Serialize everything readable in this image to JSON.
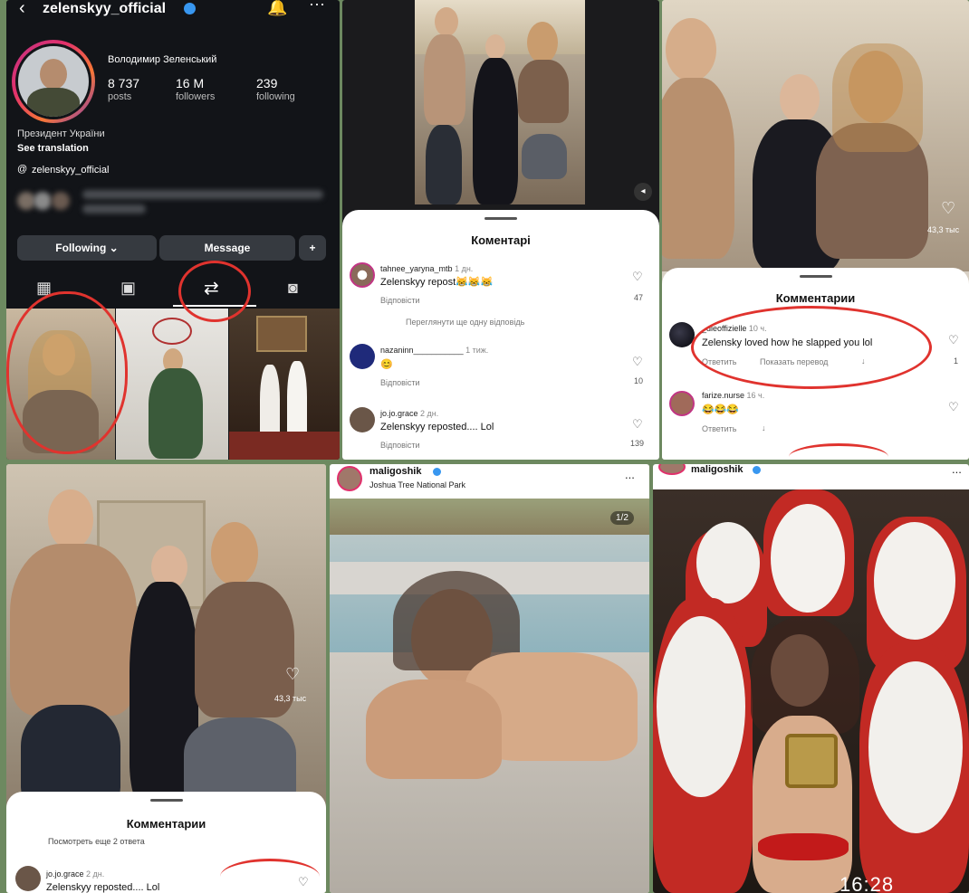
{
  "profile": {
    "username": "zelenskyy_official",
    "display_name": "Володимир Зеленський",
    "posts_count": "8 737",
    "posts_label": "posts",
    "followers_count": "16 M",
    "followers_label": "followers",
    "following_count": "239",
    "following_label": "following",
    "bio": "Президент України",
    "see_translation": "See translation",
    "threads_handle": "zelenskyy_official",
    "following_button": "Following",
    "message_button": "Message",
    "icons": {
      "back": "chevron-left-icon",
      "verified": "verified-badge-icon",
      "bell": "bell-icon",
      "more": "more-icon",
      "grid": "grid-icon",
      "reels": "reels-icon",
      "reposts": "repost-icon",
      "tagged": "tagged-icon",
      "add_user": "add-user-icon"
    }
  },
  "ukrainian_comments": {
    "title": "Коментарі",
    "comments": [
      {
        "user": "tahnee_yaryna_mtb",
        "time": "1 дн.",
        "text": "Zelenskyy repost😹😹😹",
        "reply": "Відповісти",
        "likes": "47"
      },
      {
        "more_replies": "Переглянути ще одну відповідь"
      },
      {
        "user": "nazaninn___________",
        "time": "1 тиж.",
        "text": "😊",
        "reply": "Відповісти",
        "likes": "10"
      },
      {
        "user": "jo.jo.grace",
        "time": "2 дн.",
        "text": "Zelenskyy reposted.... Lol",
        "reply": "Відповісти",
        "likes": "139"
      }
    ]
  },
  "russian_comments_top": {
    "title": "Комментарии",
    "side_likes": "43,3 тыс",
    "comments": [
      {
        "user": "_dieoffizielle",
        "time": "10 ч.",
        "text": "Zelensky loved how he slapped you lol",
        "reply": "Ответить",
        "translate": "Показать перевод",
        "likes": "1"
      },
      {
        "user": "farize.nurse",
        "time": "16 ч.",
        "text": "😂😂😂",
        "reply": "Ответить"
      }
    ]
  },
  "russian_comments_bottom": {
    "title": "Комментарии",
    "more_replies": "Посмотреть еще 2 ответа",
    "side_likes": "43,3 тыс",
    "comments": [
      {
        "user": "jo.jo.grace",
        "time": "2 дн.",
        "text": "Zelenskyy reposted.... Lol"
      }
    ]
  },
  "post_pool": {
    "user": "maligoshik",
    "location": "Joshua Tree National Park",
    "counter": "1/2",
    "more": "..."
  },
  "post_santa": {
    "user": "maligoshik",
    "more": "...",
    "clock": "16:28"
  },
  "colors": {
    "annotation_red": "#e0332e",
    "ig_dark": "#121418",
    "verified_blue": "#3897f0"
  }
}
